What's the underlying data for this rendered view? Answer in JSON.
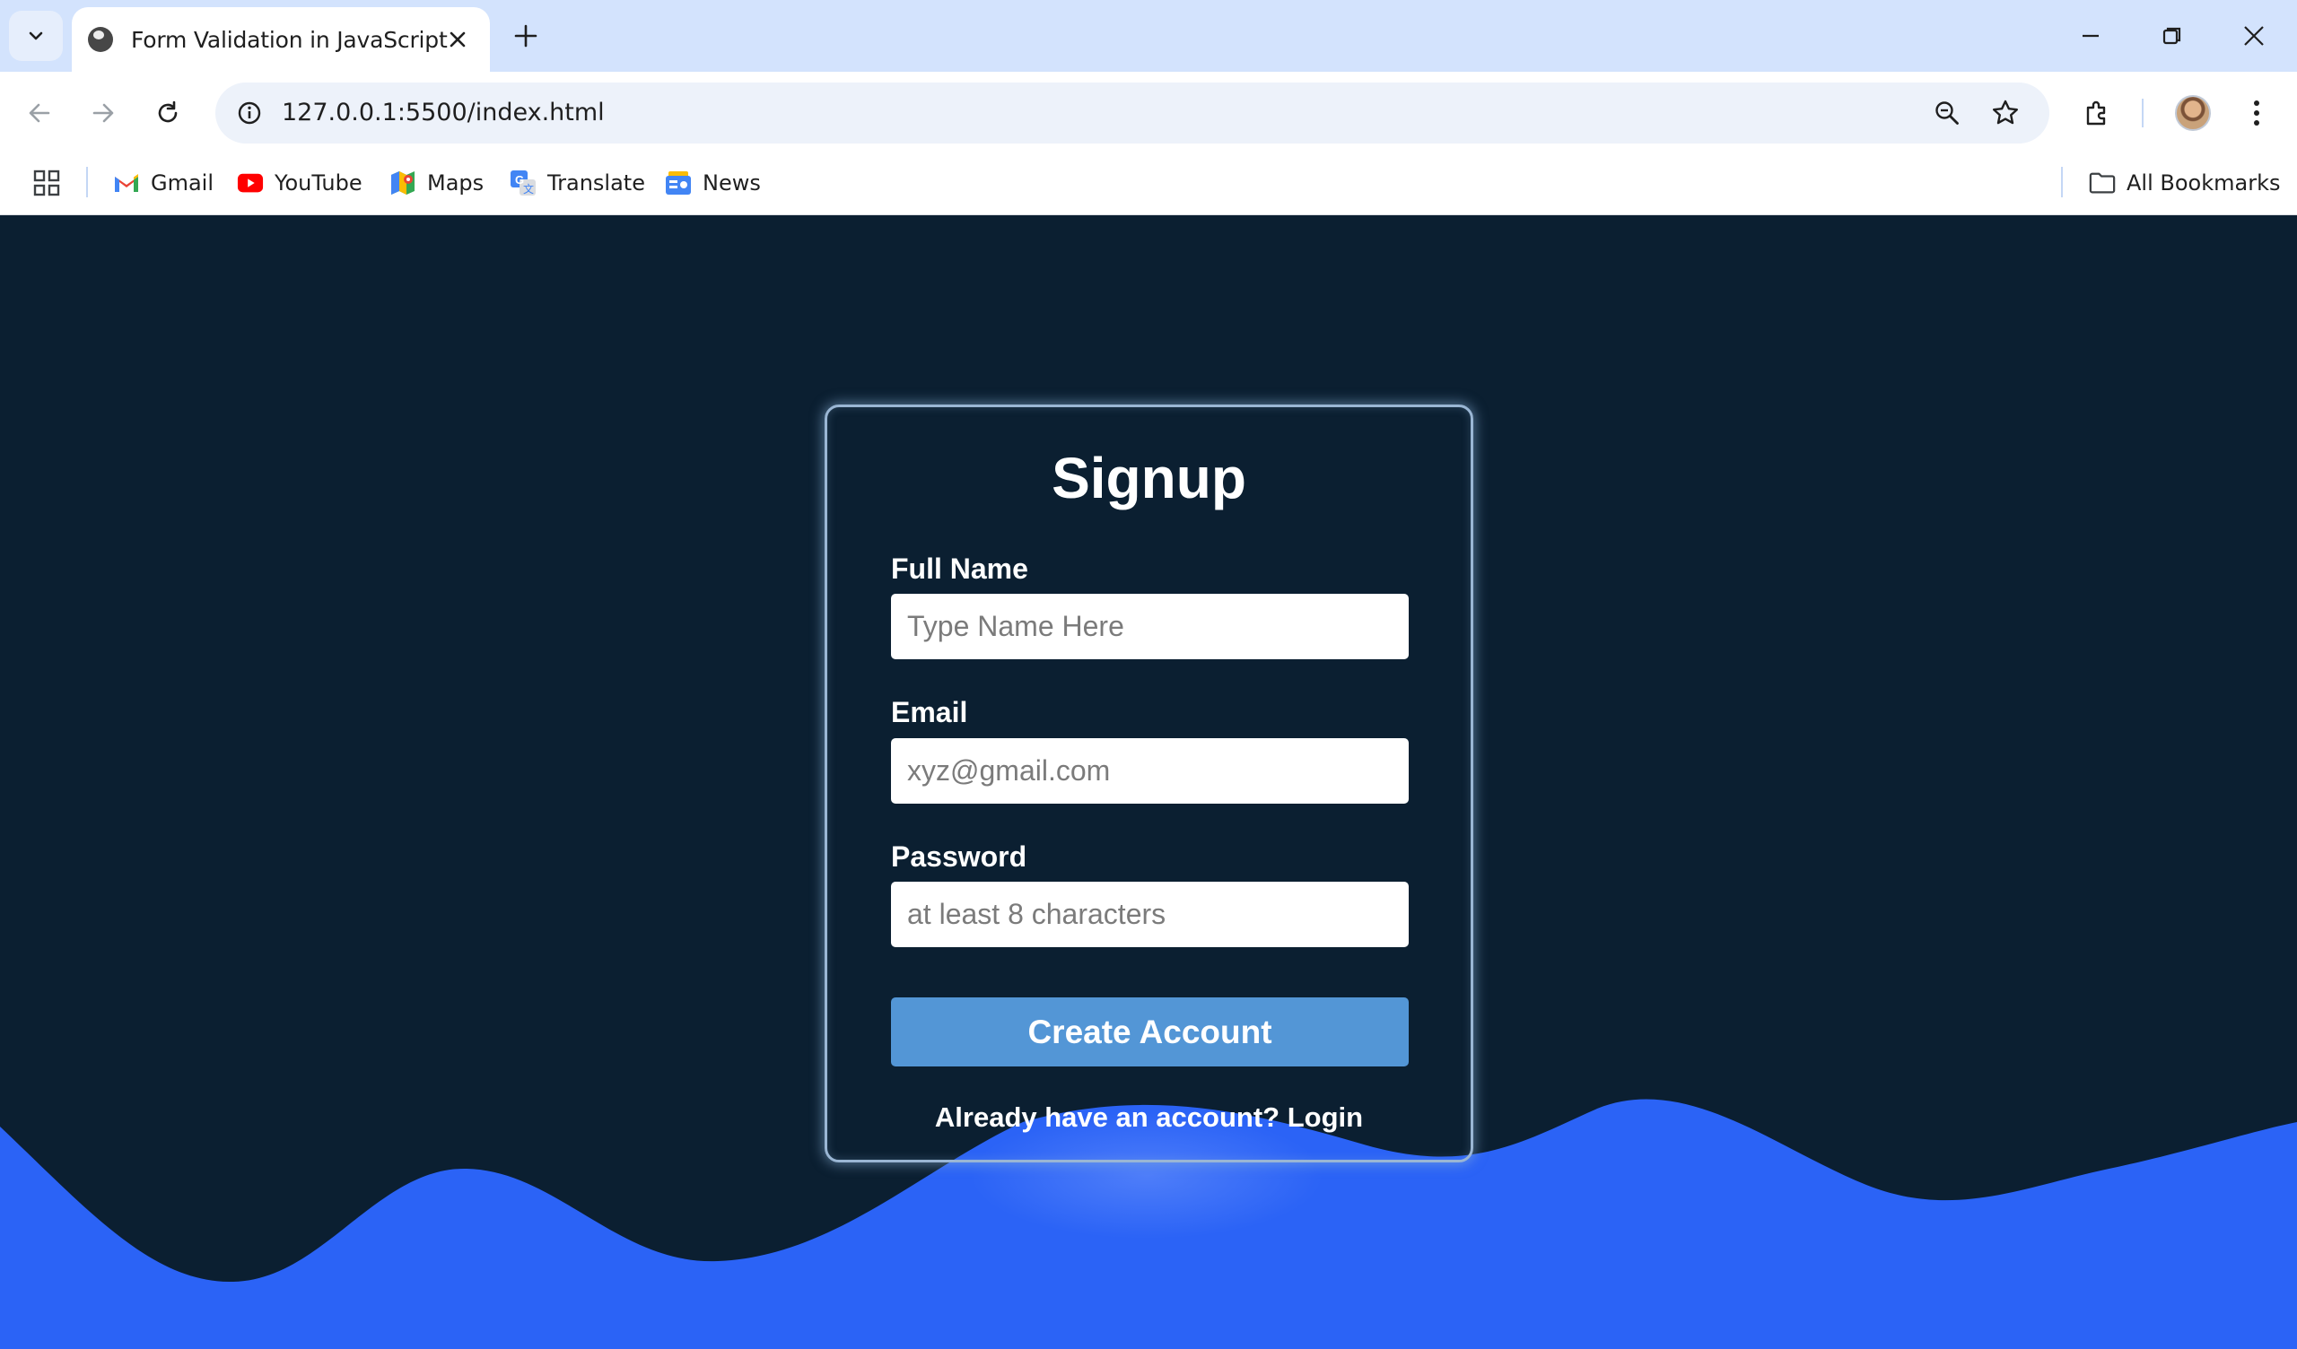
{
  "browser": {
    "tab_title": "Form Validation in JavaScript",
    "url": "127.0.0.1:5500/index.html",
    "bookmarks": [
      {
        "label": "Gmail",
        "icon": "gmail-icon"
      },
      {
        "label": "YouTube",
        "icon": "youtube-icon"
      },
      {
        "label": "Maps",
        "icon": "maps-icon"
      },
      {
        "label": "Translate",
        "icon": "translate-icon"
      },
      {
        "label": "News",
        "icon": "news-icon"
      }
    ],
    "all_bookmarks_label": "All Bookmarks"
  },
  "page": {
    "colors": {
      "background": "#0b1f31",
      "wave": "#2b63f6",
      "button": "#5396d6",
      "text": "#ffffff"
    },
    "form": {
      "title": "Signup",
      "fields": [
        {
          "label": "Full Name",
          "placeholder": "Type Name Here",
          "value": ""
        },
        {
          "label": "Email",
          "placeholder": "xyz@gmail.com",
          "value": ""
        },
        {
          "label": "Password",
          "placeholder": "at least 8 characters",
          "value": ""
        }
      ],
      "submit_label": "Create Account",
      "login_prompt": "Already have an account?",
      "login_link": "Login"
    }
  }
}
